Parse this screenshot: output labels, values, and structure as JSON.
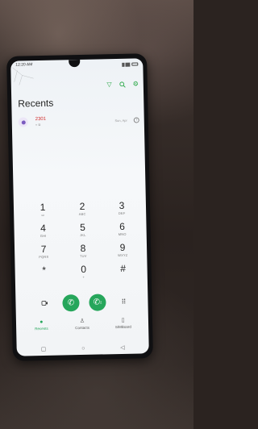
{
  "status_bar": {
    "time": "12:20 AM"
  },
  "toolbar": {
    "icons": [
      "filter-icon",
      "search-icon",
      "settings-icon"
    ],
    "accent": "#28a745"
  },
  "title": "Recents",
  "recents": [
    {
      "number": "2301",
      "meta": "× ⧉",
      "time": "Sun, Apr",
      "number_color": "#d32f2f"
    }
  ],
  "keypad": [
    [
      {
        "digit": "1",
        "letters": "ω"
      },
      {
        "digit": "2",
        "letters": "ABC"
      },
      {
        "digit": "3",
        "letters": "DEF"
      }
    ],
    [
      {
        "digit": "4",
        "letters": "GHI"
      },
      {
        "digit": "5",
        "letters": "JKL"
      },
      {
        "digit": "6",
        "letters": "MNO"
      }
    ],
    [
      {
        "digit": "7",
        "letters": "PQRS"
      },
      {
        "digit": "8",
        "letters": "TUV"
      },
      {
        "digit": "9",
        "letters": "WXYZ"
      }
    ],
    [
      {
        "digit": "*",
        "letters": ""
      },
      {
        "digit": "0",
        "letters": "+"
      },
      {
        "digit": "#",
        "letters": ""
      }
    ]
  ],
  "call_row": {
    "left_icon": "video-icon",
    "call_buttons": [
      "call-sim1-icon",
      "call-sim2-icon"
    ],
    "sim2_badge": "2",
    "right_icon": "dialpad-icon",
    "call_color": "#26a65b"
  },
  "bottom_nav": [
    {
      "label": "Recents",
      "icon": "clock-icon",
      "active": true
    },
    {
      "label": "Contacts",
      "icon": "person-icon",
      "active": false
    },
    {
      "label": "SIMBoard",
      "icon": "sim-icon",
      "active": false
    }
  ]
}
